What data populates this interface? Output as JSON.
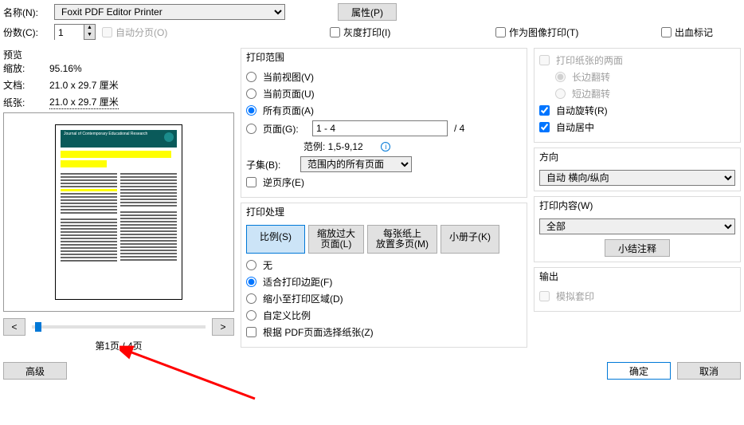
{
  "top": {
    "name_label": "名称(N):",
    "printer": "Foxit PDF Editor Printer",
    "properties_btn": "属性(P)",
    "copies_label": "份数(C):",
    "copies_value": "1",
    "collate": "自动分页(O)",
    "grayscale": "灰度打印(I)",
    "as_image": "作为图像打印(T)",
    "bleed": "出血标记"
  },
  "preview": {
    "title": "预览",
    "scale_label": "缩放:",
    "scale_value": "95.16%",
    "doc_label": "文档:",
    "doc_value": "21.0 x 29.7 厘米",
    "paper_label": "纸张:",
    "paper_value": "21.0 x 29.7 厘米",
    "page_info": "第1页 / 4页",
    "prev": "<",
    "next": ">"
  },
  "range": {
    "title": "打印范围",
    "current_view": "当前视图(V)",
    "current_page": "当前页面(U)",
    "all_pages": "所有页面(A)",
    "pages": "页面(G):",
    "pages_value": "1 - 4",
    "total": "/ 4",
    "example": "范例: 1,5-9,12",
    "subset_label": "子集(B):",
    "subset_value": "范围内的所有页面",
    "reverse": "逆页序(E)"
  },
  "handling": {
    "title": "打印处理",
    "tab_scale": "比例(S)",
    "tab_large": "缩放过大\n页面(L)",
    "tab_multi": "每张纸上\n放置多页(M)",
    "tab_booklet": "小册子(K)",
    "none": "无",
    "fit": "适合打印边距(F)",
    "shrink": "缩小至打印区域(D)",
    "custom": "自定义比例",
    "choose_paper": "根据 PDF页面选择纸张(Z)"
  },
  "duplex": {
    "both_sides": "打印纸张的两面",
    "long_edge": "长边翻转",
    "short_edge": "短边翻转",
    "auto_rotate": "自动旋转(R)",
    "auto_center": "自动居中"
  },
  "orientation": {
    "title": "方向",
    "value": "自动 横向/纵向"
  },
  "content": {
    "title": "打印内容(W)",
    "value": "全部",
    "summarize": "小结注释"
  },
  "output": {
    "title": "输出",
    "simulate": "模拟套印"
  },
  "buttons": {
    "advanced": "高级",
    "ok": "确定",
    "cancel": "取消"
  }
}
